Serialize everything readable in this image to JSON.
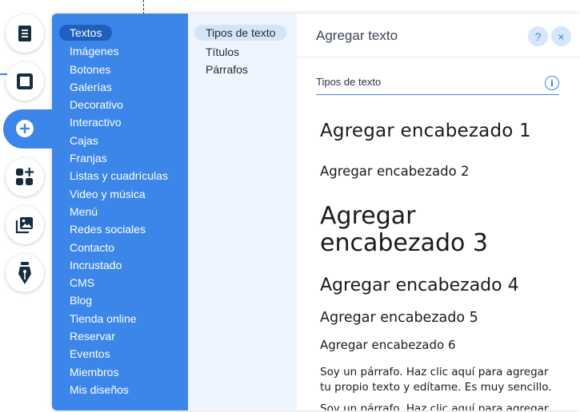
{
  "colors": {
    "accent": "#3b86e8",
    "selected_category": "#1f5fbe",
    "subcategory_background": "#eef5fe",
    "subcategory_selected": "#d3e5fb"
  },
  "toolbar": {
    "items": [
      {
        "icon": "pages-icon"
      },
      {
        "icon": "background-icon"
      },
      {
        "icon": "add-icon",
        "active": true
      },
      {
        "icon": "add-apps-icon"
      },
      {
        "icon": "media-icon"
      },
      {
        "icon": "pen-nib-icon"
      }
    ]
  },
  "categories": [
    "Textos",
    "Imágenes",
    "Botones",
    "Galerías",
    "Decorativo",
    "Interactivo",
    "Cajas",
    "Franjas",
    "Listas y cuadrículas",
    "Video y música",
    "Menú",
    "Redes sociales",
    "Contacto",
    "Incrustado",
    "CMS",
    "Blog",
    "Tienda online",
    "Reservar",
    "Eventos",
    "Miembros",
    "Mis diseños"
  ],
  "selected_category": "Textos",
  "subcategories": [
    "Tipos de texto",
    "Títulos",
    "Párrafos"
  ],
  "selected_subcategory": "Tipos de texto",
  "panel": {
    "title": "Agregar texto",
    "help_label": "?",
    "close_label": "×",
    "section_title": "Tipos de texto",
    "info_label": "i"
  },
  "presets": {
    "h1": "Agregar encabezado 1",
    "h2": "Agregar encabezado 2",
    "h3": "Agregar encabezado 3",
    "h4": "Agregar encabezado 4",
    "h5": "Agregar encabezado 5",
    "h6": "Agregar encabezado 6",
    "p1": "Soy un párrafo. Haz clic aquí para agregar tu propio texto y edítame. Es muy sencillo.",
    "p2": "Soy un párrafo. Haz clic aquí para agregar tu propio texto y edítame. Es muy sencillo."
  }
}
